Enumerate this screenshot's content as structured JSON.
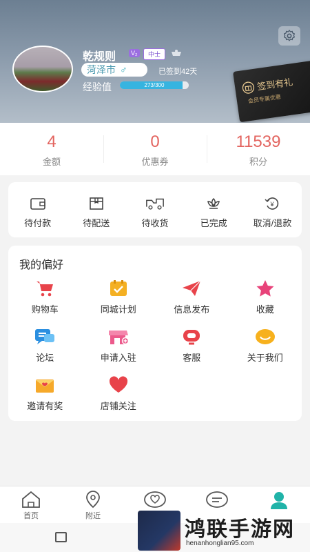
{
  "header": {
    "username": "乾规则",
    "vip_badge": "V₂",
    "rank_badge": "中士",
    "city": "菏泽市",
    "gender_symbol": "♂",
    "signed_days": "已签到42天",
    "exp_label": "经验值",
    "exp_text": "273/300",
    "exp_progress": 0.91,
    "signin_card": {
      "title": "签到有礼",
      "subtitle": "会员专属优惠"
    }
  },
  "stats": [
    {
      "value": "4",
      "label": "金额"
    },
    {
      "value": "0",
      "label": "优惠券"
    },
    {
      "value": "11539",
      "label": "积分"
    }
  ],
  "orders": [
    {
      "label": "待付款",
      "icon": "wallet-icon"
    },
    {
      "label": "待配送",
      "icon": "package-icon"
    },
    {
      "label": "待收货",
      "icon": "truck-icon"
    },
    {
      "label": "已完成",
      "icon": "lotus-icon"
    },
    {
      "label": "取消/退款",
      "icon": "refund-icon"
    }
  ],
  "preferences": {
    "title": "我的偏好",
    "items": [
      {
        "label": "购物车",
        "icon": "cart-icon"
      },
      {
        "label": "同城计划",
        "icon": "plan-icon"
      },
      {
        "label": "信息发布",
        "icon": "send-icon"
      },
      {
        "label": "收藏",
        "icon": "star-icon"
      },
      {
        "label": "论坛",
        "icon": "chat-icon"
      },
      {
        "label": "申请入驻",
        "icon": "store-icon"
      },
      {
        "label": "客服",
        "icon": "headset-icon"
      },
      {
        "label": "关于我们",
        "icon": "smile-icon"
      },
      {
        "label": "邀请有奖",
        "icon": "envelope-icon"
      },
      {
        "label": "店铺关注",
        "icon": "heart-icon"
      }
    ]
  },
  "bottom_nav": [
    {
      "label": "首页",
      "icon": "home-icon"
    },
    {
      "label": "附近",
      "icon": "location-icon"
    },
    {
      "label": "",
      "icon": "heart-chat-icon"
    },
    {
      "label": "",
      "icon": "message-icon"
    },
    {
      "label": "",
      "icon": "user-icon"
    }
  ],
  "watermark": {
    "title": "鸿联手游网",
    "url": "henanhonglian95.com"
  },
  "colors": {
    "accent": "#e3645f",
    "exp_bar": "#36b4e0",
    "active_nav": "#20b3a8"
  }
}
